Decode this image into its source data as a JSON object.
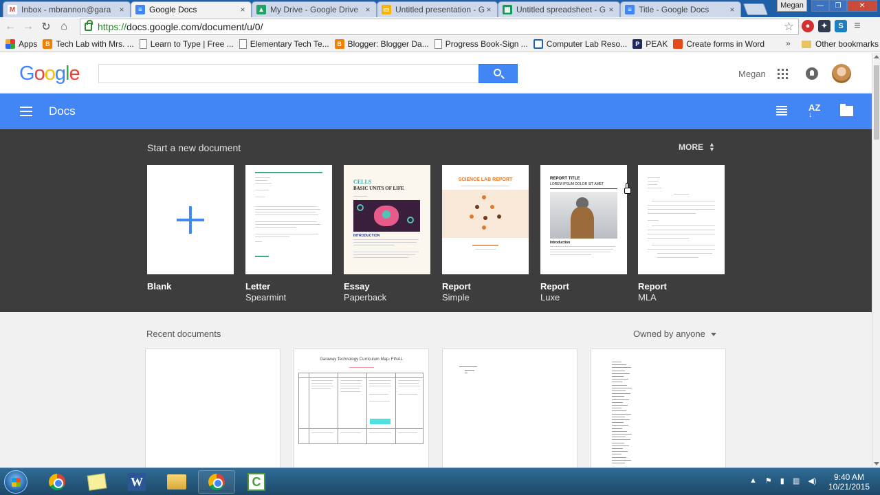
{
  "browser": {
    "tabs": [
      {
        "title": "Inbox - mbrannon@gara",
        "icon": "gmail-icon",
        "color": "#d44638"
      },
      {
        "title": "Google Docs",
        "icon": "docs-icon",
        "color": "#4285f4",
        "active": true
      },
      {
        "title": "My Drive - Google Drive",
        "icon": "drive-icon",
        "color": "#1fa463"
      },
      {
        "title": "Untitled presentation - G",
        "icon": "slides-icon",
        "color": "#f4b400"
      },
      {
        "title": "Untitled spreadsheet - G",
        "icon": "sheets-icon",
        "color": "#0f9d58"
      },
      {
        "title": "Title - Google Docs",
        "icon": "docs-icon",
        "color": "#4285f4"
      }
    ],
    "tab_close": "×",
    "profile_name": "Megan",
    "url_scheme": "https://",
    "url_rest": "docs.google.com/document/u/0/",
    "bookmarks": [
      {
        "label": "Apps"
      },
      {
        "label": "Tech Lab with Mrs. ..."
      },
      {
        "label": "Learn to Type | Free ..."
      },
      {
        "label": "Elementary Tech Te..."
      },
      {
        "label": "Blogger: Blogger Da..."
      },
      {
        "label": "Progress Book-Sign ..."
      },
      {
        "label": "Computer Lab Reso..."
      },
      {
        "label": "PEAK"
      },
      {
        "label": "Create forms in Word"
      }
    ],
    "bookmarks_overflow": "»",
    "other_bookmarks": "Other bookmarks"
  },
  "google_header": {
    "logo": [
      "G",
      "o",
      "o",
      "g",
      "l",
      "e"
    ],
    "logo_colors": [
      "#4285f4",
      "#ea4335",
      "#fbbc05",
      "#4285f4",
      "#34a853",
      "#ea4335"
    ],
    "user": "Megan"
  },
  "docs_bar": {
    "title": "Docs",
    "sort_label": "AZ"
  },
  "templates": {
    "heading": "Start a new document",
    "more": "MORE",
    "items": [
      {
        "name": "Blank",
        "sub": ""
      },
      {
        "name": "Letter",
        "sub": "Spearmint"
      },
      {
        "name": "Essay",
        "sub": "Paperback"
      },
      {
        "name": "Report",
        "sub": "Simple"
      },
      {
        "name": "Report",
        "sub": "Luxe"
      },
      {
        "name": "Report",
        "sub": "MLA"
      }
    ],
    "essay_thumb": {
      "title1": "CELLS",
      "title2": "BASIC UNITS OF LIFE",
      "section": "INTRODUCTION"
    },
    "simple_thumb": {
      "title": "SCIENCE LAB REPORT"
    },
    "luxe_thumb": {
      "title1": "REPORT TITLE",
      "title2": "LOREM IPSUM DOLOR SIT AMET",
      "section": "Introduction"
    }
  },
  "recent": {
    "heading": "Recent documents",
    "owner_filter": "Owned by anyone",
    "doc2_title": "Garaway Technology Curriculum Map- FINAL"
  },
  "taskbar": {
    "time": "9:40 AM",
    "date": "10/21/2015"
  }
}
